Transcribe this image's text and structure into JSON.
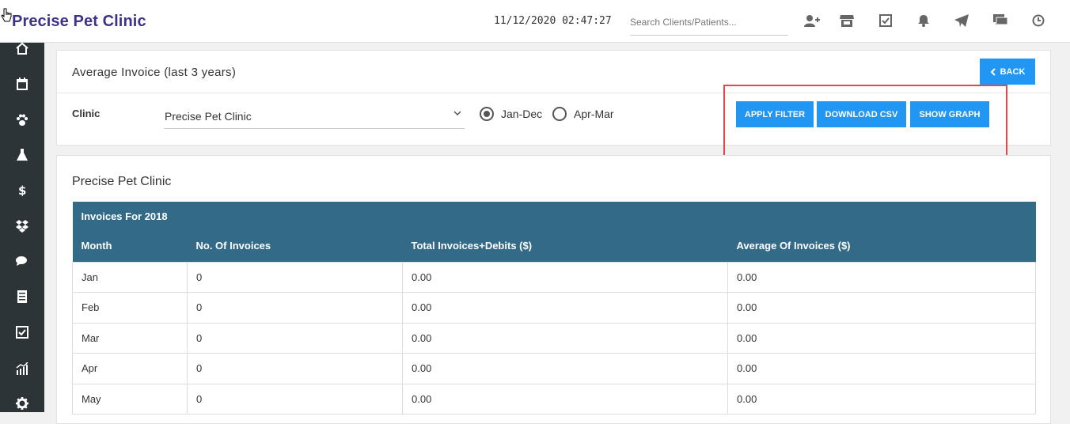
{
  "header": {
    "brand": "Precise Pet Clinic",
    "datetime": "11/12/2020 02:47:27",
    "search_placeholder": "Search Clients/Patients...",
    "icons": [
      "add-client-icon",
      "store-icon",
      "checklist-icon",
      "bell-icon",
      "send-icon",
      "chat-icon",
      "clock-icon"
    ]
  },
  "sidebar": {
    "items": [
      "home-icon",
      "calendar-icon",
      "paw-icon",
      "flask-icon",
      "dollar-icon",
      "dropbox-icon",
      "comments-icon",
      "list-icon",
      "checkbox-icon",
      "chart-icon",
      "gear-icon"
    ]
  },
  "filter": {
    "title": "Average Invoice (last 3 years)",
    "back_label": "BACK",
    "clinic_label": "Clinic",
    "clinic_value": "Precise Pet Clinic",
    "radio_jan_dec": "Jan-Dec",
    "radio_apr_mar": "Apr-Mar",
    "selected_range": "Jan-Dec",
    "apply_label": "APPLY FILTER",
    "download_label": "DOWNLOAD CSV",
    "graph_label": "SHOW GRAPH"
  },
  "report": {
    "clinic_name": "Precise Pet Clinic",
    "caption": "Invoices For 2018",
    "columns": [
      "Month",
      "No. Of Invoices",
      "Total Invoices+Debits ($)",
      "Average Of Invoices ($)"
    ],
    "rows": [
      [
        "Jan",
        "0",
        "0.00",
        "0.00"
      ],
      [
        "Feb",
        "0",
        "0.00",
        "0.00"
      ],
      [
        "Mar",
        "0",
        "0.00",
        "0.00"
      ],
      [
        "Apr",
        "0",
        "0.00",
        "0.00"
      ],
      [
        "May",
        "0",
        "0.00",
        "0.00"
      ]
    ]
  },
  "colors": {
    "brand": "#3b3486",
    "primary_button": "#2196f3",
    "table_header": "#336a88",
    "sidebar": "#2d3438",
    "highlight": "#e4474c"
  }
}
